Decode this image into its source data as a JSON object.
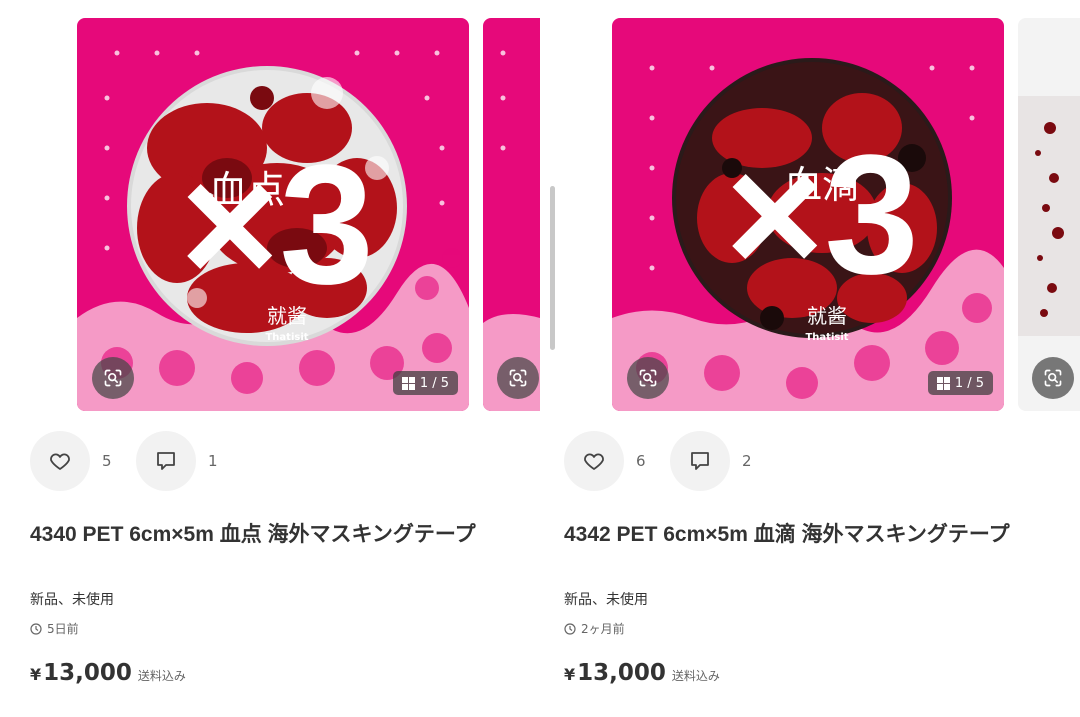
{
  "items": [
    {
      "id_label": "left",
      "overlay_text": "×3",
      "tape_label": "血点",
      "tape_subtitle": "就酱",
      "tape_brand": "Thatisit",
      "image_counter": "1 / 5",
      "likes": "5",
      "comments": "1",
      "title": "4340 PET 6cm×5m 血点 海外マスキングテープ",
      "condition": "新品、未使用",
      "posted": "5日前",
      "currency": "¥",
      "price": "13,000",
      "shipping": "送料込み"
    },
    {
      "id_label": "right",
      "overlay_text": "×3",
      "tape_label": "血滴",
      "tape_subtitle": "就酱",
      "tape_brand": "Thatisit",
      "image_counter": "1 / 5",
      "likes": "6",
      "comments": "2",
      "title": "4342 PET 6cm×5m 血滴 海外マスキングテープ",
      "condition": "新品、未使用",
      "posted": "2ヶ月前",
      "currency": "¥",
      "price": "13,000",
      "shipping": "送料込み"
    }
  ],
  "icons": {
    "zoom": "image-search-icon",
    "gallery": "grid-icon",
    "like": "heart-icon",
    "comment": "comment-icon",
    "time": "clock-icon"
  },
  "colors": {
    "background_pink": "#e6097a",
    "blood_red": "#b3121a",
    "text_primary": "#333333",
    "text_secondary": "#666666",
    "button_bg": "#f2f2f2"
  }
}
